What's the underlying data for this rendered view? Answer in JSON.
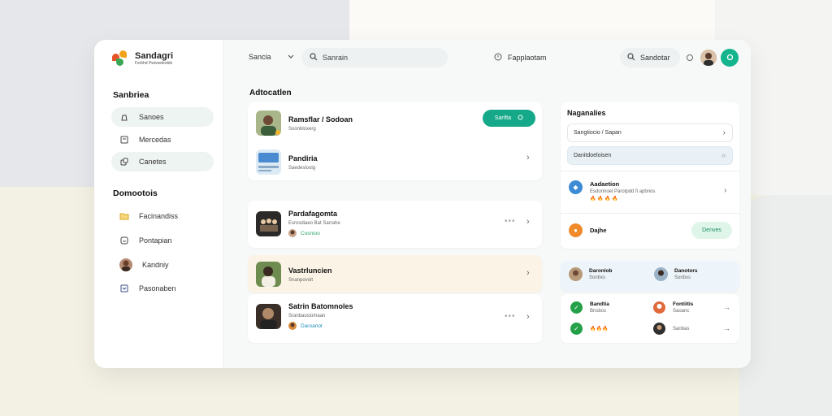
{
  "app": {
    "name": "Sandagri",
    "tagline": "Fsrbhd Pwivwdeobib"
  },
  "sidebar": {
    "section1_title": "Sanbriea",
    "items1": [
      {
        "label": "Sanoes",
        "icon": "person-icon"
      },
      {
        "label": "Mercedas",
        "icon": "document-icon"
      },
      {
        "label": "Canetes",
        "icon": "link-icon"
      }
    ],
    "section2_title": "Domootois",
    "items2": [
      {
        "label": "Facinandiss",
        "icon": "folder-icon"
      },
      {
        "label": "Pontapian",
        "icon": "monitor-icon"
      },
      {
        "label": "Kandniy",
        "icon": "avatar"
      },
      {
        "label": "Pasonaben",
        "icon": "calendar-icon"
      }
    ]
  },
  "topbar": {
    "select_label": "Sancia",
    "search_placeholder": "Sanrain",
    "middle_label": "Fapplaotam",
    "search2_label": "Sandotar"
  },
  "main": {
    "title": "Adtocatlen",
    "cards": [
      {
        "title": "Ramsflar / Sodoan",
        "sub": "Soonbloxerg",
        "button": "Sarifta"
      },
      {
        "title": "Pandiria",
        "sub": "Saedesloolg"
      },
      {
        "title": "Pardafagomta",
        "sub": "Esrosdiaeo Bat Sarrahe",
        "chip": "Cosnioo"
      },
      {
        "title": "Vastrluncien",
        "sub": "Snanpovolt"
      },
      {
        "title": "Satrin Batomnoles",
        "sub": "Sranbaosiomaan",
        "chip": "Daroanot"
      }
    ]
  },
  "right": {
    "title": "Naganalies",
    "field1": "Sangtiocio / Sapan",
    "field2": "Danitdoeloisen",
    "row1": {
      "title": "Aadaetion",
      "sub": "Esdonnoel Parotpdd fi apbnos",
      "counts": "🔥 🔥 🔥 🔥"
    },
    "row2": {
      "title": "Dajhe",
      "button": "Denves"
    },
    "people": [
      {
        "name": "Daronlob",
        "sub": "Sonbxs"
      },
      {
        "name": "Danotors",
        "sub": "Sonbxs"
      }
    ],
    "list": [
      {
        "name": "Bandtia",
        "sub": "Bnsbos"
      },
      {
        "name": "Fontiitis",
        "sub": "Saoanc"
      },
      {
        "name": "🔥🔥🔥",
        "sub": ""
      },
      {
        "name": "",
        "sub": "Sanbas"
      }
    ]
  },
  "colors": {
    "accent": "#15a989",
    "highlight": "#fbf4e6"
  }
}
